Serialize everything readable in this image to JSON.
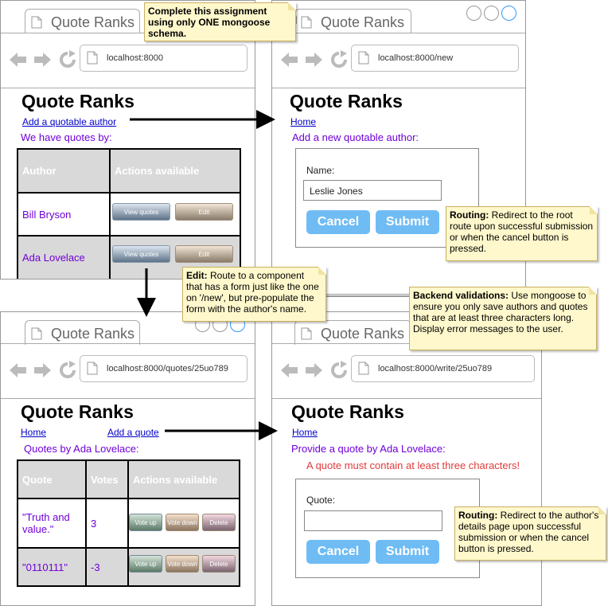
{
  "brand": "Quote Ranks",
  "windows": {
    "home": {
      "tab": "Quote Ranks",
      "url": "localhost:8000",
      "title": "Quote Ranks",
      "add_link": "Add a quotable author",
      "subtitle": "We have quotes by:",
      "table": {
        "headers": [
          "Author",
          "Actions available"
        ],
        "rows": [
          {
            "name": "Bill Bryson",
            "view": "View quotes",
            "edit": "Edit"
          },
          {
            "name": "Ada Lovelace",
            "view": "View quotes",
            "edit": "Edit"
          }
        ]
      }
    },
    "new": {
      "tab": "Quote Ranks",
      "url": "localhost:8000/new",
      "title": "Quote Ranks",
      "home_link": "Home",
      "subtitle": "Add a new quotable author:",
      "name_label": "Name:",
      "name_value": "Leslie Jones",
      "cancel": "Cancel",
      "submit": "Submit"
    },
    "quotes": {
      "tab": "Quote Ranks",
      "url": "localhost:8000/quotes/25uo789",
      "title": "Quote Ranks",
      "home_link": "Home",
      "add_quote_link": "Add a quote",
      "subtitle": "Quotes by Ada Lovelace:",
      "table": {
        "headers": [
          "Quote",
          "Votes",
          "Actions available"
        ],
        "rows": [
          {
            "quote": "\"Truth and value.\"",
            "votes": "3",
            "up": "Vote up",
            "down": "Vote down",
            "del": "Delete"
          },
          {
            "quote": "\"0110111\"",
            "votes": "-3",
            "up": "Vote up",
            "down": "Vote down",
            "del": "Delete"
          }
        ]
      }
    },
    "write": {
      "tab": "Quote Ranks",
      "url": "localhost:8000/write/25uo789",
      "title": "Quote Ranks",
      "home_link": "Home",
      "subtitle": "Provide a quote by Ada Lovelace:",
      "error": "A quote must contain at least three characters!",
      "quote_label": "Quote:",
      "quote_value": "",
      "cancel": "Cancel",
      "submit": "Submit"
    }
  },
  "notes": {
    "top": {
      "text": "Complete this assignment using only ONE mongoose schema."
    },
    "routing1": {
      "bold": "Routing:",
      "text": " Redirect to the root route upon successful submission or when the cancel button is pressed."
    },
    "edit": {
      "bold": "Edit:",
      "text": " Route to a component that has a form just like the one on '/new', but pre-populate the form with the author's name."
    },
    "backend": {
      "bold": "Backend validations:",
      "text": " Use mongoose to ensure you only save authors and quotes that are at least three characters long. Display error messages to the user."
    },
    "routing2": {
      "bold": "Routing:",
      "text": " Redirect to the author's details page upon successful submission or when the cancel button is pressed."
    }
  },
  "colors": {
    "accent_purple": "#6f00d8",
    "error_red": "#e03c3c",
    "button_blue": "#6fbcf5",
    "note_yellow": "#fff8cc"
  }
}
